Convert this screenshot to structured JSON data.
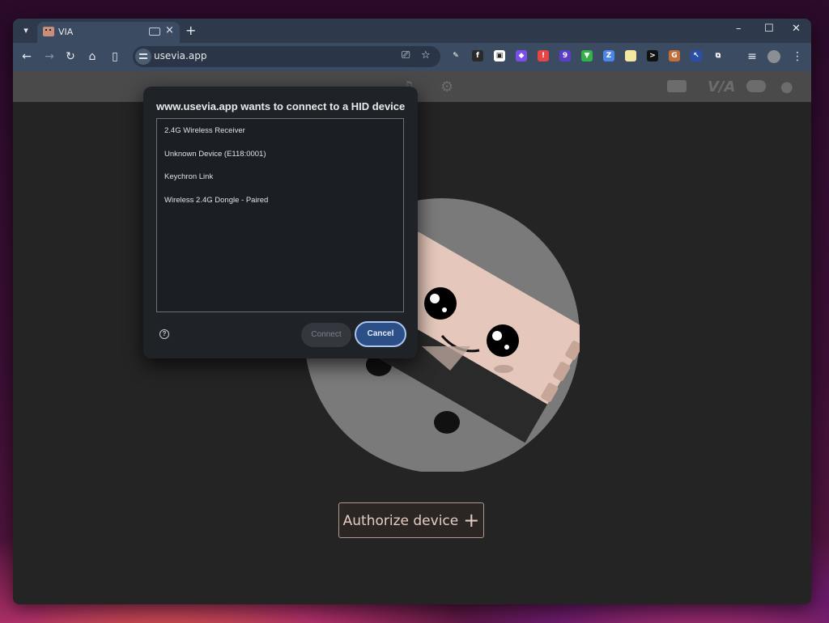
{
  "browser": {
    "tab_title": "VIA",
    "tab_close": "×",
    "new_tab": "+",
    "url": "usevia.app",
    "window_controls": {
      "minimize": "–",
      "maximize": "☐",
      "close": "✕"
    },
    "nav": {
      "back": "←",
      "forward": "→",
      "reload": "↻",
      "home": "⌂"
    },
    "extensions": [
      {
        "name": "eyedropper-icon",
        "glyph": "✎",
        "color": "#3b4b62"
      },
      {
        "name": "fx-extension-icon",
        "glyph": "f",
        "color": "#2a2a2a"
      },
      {
        "name": "tab-extension-icon",
        "glyph": "▣",
        "color": "#ffffff"
      },
      {
        "name": "flame-extension-icon",
        "glyph": "◆",
        "color": "#7a4ee8"
      },
      {
        "name": "alert-extension-icon",
        "glyph": "!",
        "color": "#e54545"
      },
      {
        "name": "badge-extension-icon",
        "glyph": "9",
        "color": "#5b3ec7"
      },
      {
        "name": "shield-extension-icon",
        "glyph": "▼",
        "color": "#35b14a"
      },
      {
        "name": "translate-extension-icon",
        "glyph": "Z",
        "color": "#4a86e8"
      },
      {
        "name": "note-extension-icon",
        "glyph": "",
        "color": "#f3e7a2"
      },
      {
        "name": "terminal-extension-icon",
        "glyph": ">",
        "color": "#111111"
      },
      {
        "name": "g-extension-icon",
        "glyph": "G",
        "color": "#c2703a"
      },
      {
        "name": "cursor-extension-icon",
        "glyph": "↖",
        "color": "#2b4fa8"
      },
      {
        "name": "puzzle-extension-icon",
        "glyph": "⧉",
        "color": "#3b4b62"
      }
    ]
  },
  "dialog": {
    "title": "www.usevia.app wants to connect to a HID device",
    "devices": [
      "2.4G Wireless Receiver",
      "Unknown Device (E118:0001)",
      "Keychron Link",
      "Wireless 2.4G Dongle - Paired"
    ],
    "help": "?",
    "connect_label": "Connect",
    "cancel_label": "Cancel"
  },
  "page": {
    "authorize_label": "Authorize device",
    "authorize_plus": "+",
    "header_logo": "V/A"
  }
}
